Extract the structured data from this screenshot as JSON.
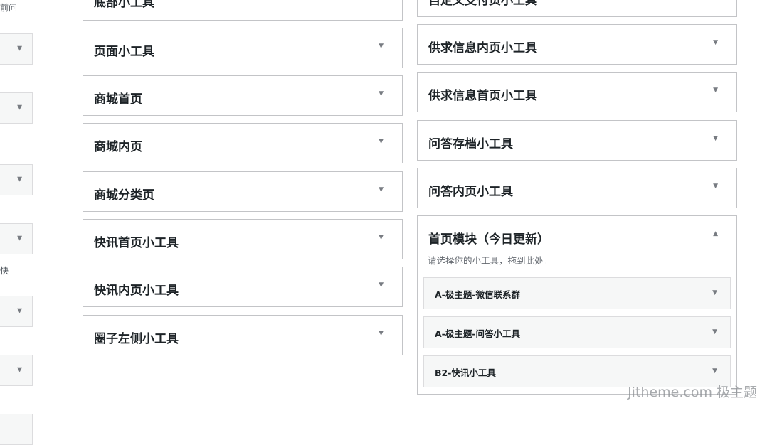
{
  "left_fragments": {
    "top_text": "前问",
    "mid_text": "快"
  },
  "left_column": [
    {
      "id": "c1",
      "title": "底部小工具"
    },
    {
      "id": "c2",
      "title": "页面小工具"
    },
    {
      "id": "c3",
      "title": "商城首页"
    },
    {
      "id": "c4",
      "title": "商城内页"
    },
    {
      "id": "c5",
      "title": "商城分类页"
    },
    {
      "id": "c6",
      "title": "快讯首页小工具"
    },
    {
      "id": "c7",
      "title": "快讯内页小工具"
    },
    {
      "id": "c8",
      "title": "圈子左侧小工具"
    }
  ],
  "right_column": [
    {
      "id": "r0",
      "title": "自定义支付页小工具"
    },
    {
      "id": "r1",
      "title": "供求信息内页小工具"
    },
    {
      "id": "r2",
      "title": "供求信息首页小工具"
    },
    {
      "id": "r3",
      "title": "问答存档小工具"
    },
    {
      "id": "r4",
      "title": "问答内页小工具"
    }
  ],
  "expanded_panel": {
    "title": "首页模块（今日更新）",
    "description": "请选择你的小工具，拖到此处。",
    "widgets": [
      {
        "title": "A-极主题-微信联系群"
      },
      {
        "title": "A-极主题-问答小工具"
      },
      {
        "title": "B2-快讯小工具"
      }
    ]
  },
  "icons": {
    "collapsed": "▼",
    "expanded": "▲"
  },
  "watermark": "Jitheme.com 极主题"
}
